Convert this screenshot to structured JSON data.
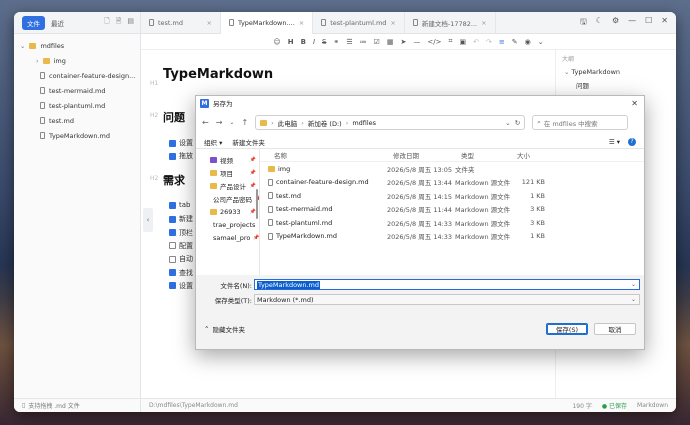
{
  "app": {
    "sidebar": {
      "files_button": "文件",
      "recent_label": "最近",
      "root_folder": "mdfiles",
      "items": [
        {
          "label": "img",
          "kind": "folder"
        },
        {
          "label": "container-feature-design...",
          "kind": "file"
        },
        {
          "label": "test-mermaid.md",
          "kind": "file"
        },
        {
          "label": "test-plantuml.md",
          "kind": "file"
        },
        {
          "label": "test.md",
          "kind": "file"
        },
        {
          "label": "TypeMarkdown.md",
          "kind": "file"
        }
      ],
      "footer": "支持拖拽 .md 文件"
    },
    "tabs": [
      {
        "label": "test.md",
        "active": false
      },
      {
        "label": "TypeMarkdown....",
        "active": true
      },
      {
        "label": "test-plantuml.md",
        "active": false
      },
      {
        "label": "新建文档-17782...",
        "active": false
      }
    ],
    "editor": {
      "h1_mark": "H1",
      "h2_mark": "H2",
      "title": "TypeMarkdown",
      "section1": "问题",
      "section1_items": [
        {
          "text": "设置",
          "checked": true
        },
        {
          "text": "拖放",
          "checked": true
        }
      ],
      "section2": "需求",
      "section2_items": [
        {
          "text": "tab",
          "checked": true
        },
        {
          "text": "新建",
          "checked": true
        },
        {
          "text": "顶栏",
          "checked": true
        },
        {
          "text": "配置",
          "checked": false
        },
        {
          "text": "自动",
          "checked": false
        },
        {
          "text": "查找",
          "checked": true
        },
        {
          "text": "设置",
          "checked": true
        }
      ]
    },
    "outline": {
      "title": "大纲",
      "items": [
        {
          "label": "TypeMarkdown",
          "level": 1
        },
        {
          "label": "问题",
          "level": 2
        }
      ]
    },
    "status": {
      "path": "D:\\mdfiles\\TypeMarkdown.md",
      "words": "190 字",
      "saved": "● 已保存",
      "mode": "Markdown"
    }
  },
  "dialog": {
    "title": "另存为",
    "breadcrumb": [
      "此电脑",
      "新加卷 (D:)",
      "mdfiles"
    ],
    "search_placeholder": "在 mdfiles 中搜索",
    "organize": "组织 ▾",
    "new_folder": "新建文件夹",
    "help": "?",
    "nav_items": [
      {
        "label": "视频",
        "icon": "video-icon"
      },
      {
        "label": "项目",
        "icon": "folder-icon"
      },
      {
        "label": "产品设计",
        "icon": "folder-icon"
      },
      {
        "label": "公司产品密码",
        "icon": "folder-icon"
      },
      {
        "label": "26933",
        "icon": "folder-icon"
      },
      {
        "label": "trae_projects",
        "icon": "folder-icon"
      },
      {
        "label": "samael_pro",
        "icon": "folder-icon"
      }
    ],
    "columns": {
      "name": "名称",
      "date": "修改日期",
      "type": "类型",
      "size": "大小"
    },
    "files": [
      {
        "name": "img",
        "date": "2026/5/8 周五 13:05",
        "type": "文件夹",
        "size": "",
        "kind": "folder"
      },
      {
        "name": "container-feature-design.md",
        "date": "2026/5/8 周五 13:44",
        "type": "Markdown 源文件",
        "size": "121 KB",
        "kind": "file"
      },
      {
        "name": "test.md",
        "date": "2026/5/8 周五 14:15",
        "type": "Markdown 源文件",
        "size": "1 KB",
        "kind": "file"
      },
      {
        "name": "test-mermaid.md",
        "date": "2026/5/8 周五 11:44",
        "type": "Markdown 源文件",
        "size": "3 KB",
        "kind": "file"
      },
      {
        "name": "test-plantuml.md",
        "date": "2026/5/8 周五 14:33",
        "type": "Markdown 源文件",
        "size": "3 KB",
        "kind": "file"
      },
      {
        "name": "TypeMarkdown.md",
        "date": "2026/5/8 周五 14:33",
        "type": "Markdown 源文件",
        "size": "1 KB",
        "kind": "file"
      }
    ],
    "filename_label": "文件名(N):",
    "filename_value": "TypeMarkdown.md",
    "filetype_label": "保存类型(T):",
    "filetype_value": "Markdown (*.md)",
    "hide_folders": "隐藏文件夹",
    "save": "保存(S)",
    "cancel": "取消"
  },
  "colors": {
    "accent": "#2f6fe0",
    "folder": "#e9b949",
    "saved": "#2a9d4a"
  }
}
